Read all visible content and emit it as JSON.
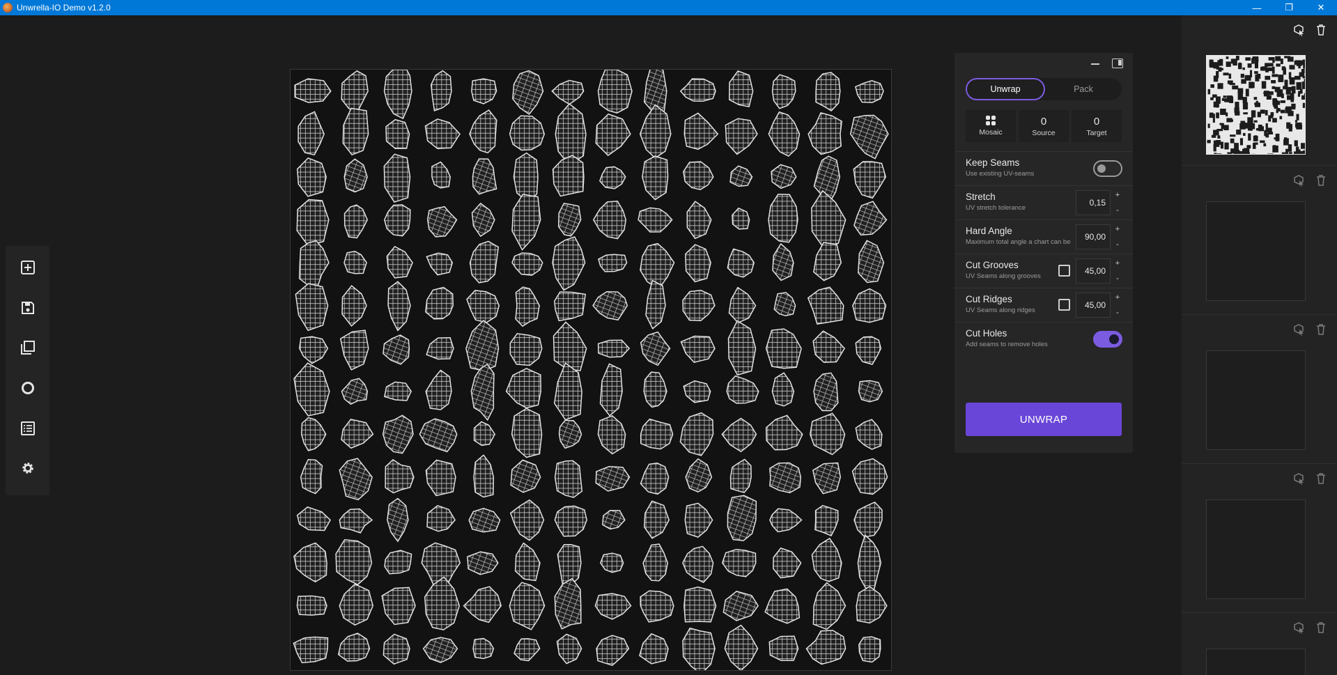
{
  "window": {
    "title": "Unwrella-IO Demo v1.2.0",
    "controls": [
      "—",
      "❐",
      "✕"
    ]
  },
  "left_toolbar": {
    "items": [
      {
        "icon": "add-icon"
      },
      {
        "icon": "save-icon"
      },
      {
        "icon": "layers-icon"
      },
      {
        "icon": "circle-icon"
      },
      {
        "icon": "list-icon"
      },
      {
        "icon": "gear-icon"
      }
    ]
  },
  "panel": {
    "tabs": [
      {
        "label": "Unwrap",
        "active": true
      },
      {
        "label": "Pack",
        "active": false
      }
    ],
    "stats": {
      "mosaic_label": "Mosaic",
      "source_value": "0",
      "source_label": "Source",
      "target_value": "0",
      "target_label": "Target"
    },
    "options": {
      "keep_seams": {
        "title": "Keep Seams",
        "sub": "Use existing UV-seams",
        "enabled": false
      },
      "stretch": {
        "title": "Stretch",
        "sub": "UV stretch tolerance",
        "value": "0,15"
      },
      "hard_angle": {
        "title": "Hard Angle",
        "sub": "Maximum total angle a chart can be",
        "value": "90,00"
      },
      "cut_grooves": {
        "title": "Cut Grooves",
        "sub": "UV Seams along grooves",
        "value": "45,00",
        "checked": false
      },
      "cut_ridges": {
        "title": "Cut Ridges",
        "sub": "UV Seams along ridges",
        "value": "45,00",
        "checked": false
      },
      "cut_holes": {
        "title": "Cut Holes",
        "sub": "Add seams to remove holes",
        "enabled": true
      }
    },
    "plus": "+",
    "minus": "-",
    "unwrap_button": "UNWRAP"
  },
  "colors": {
    "accent": "#6a46d8",
    "titlebar": "#0078d7",
    "background": "#1c1c1c"
  }
}
